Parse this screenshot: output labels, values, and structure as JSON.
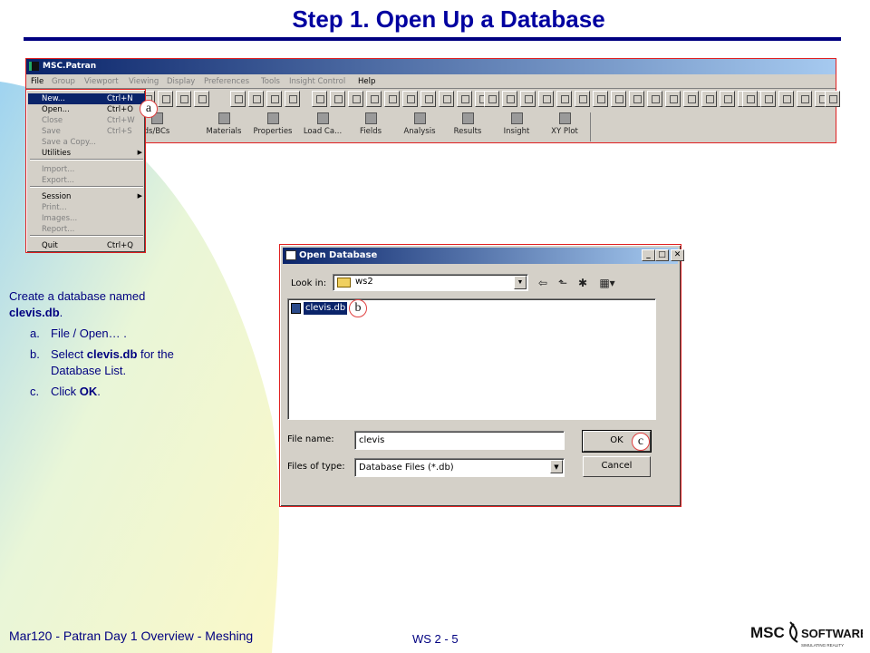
{
  "slide": {
    "title": "Step 1.  Open Up a Database",
    "footer_left": "Mar120 - Patran Day 1 Overview - Meshing",
    "footer_page": "WS 2 - 5",
    "logo_text": "MSC",
    "logo_text2": "SOFTWARE",
    "logo_tagline": "SIMULATING REALITY",
    "colors": {
      "title": "#0000a0",
      "rule": "#000080",
      "callout_border": "#e04040"
    }
  },
  "patran": {
    "window_title": "MSC.Patran",
    "menus": [
      "File",
      "Group",
      "Viewport",
      "Viewing",
      "Display",
      "Preferences",
      "Tools",
      "Insight Control",
      "Help"
    ],
    "app_buttons": [
      "ds/BCs",
      "Materials",
      "Properties",
      "Load Ca...",
      "Fields",
      "Analysis",
      "Results",
      "Insight",
      "XY Plot"
    ],
    "file_menu": [
      {
        "label": "New...",
        "accel": "Ctrl+N",
        "state": "selected"
      },
      {
        "label": "Open...",
        "accel": "Ctrl+O",
        "state": "enabled"
      },
      {
        "label": "Close",
        "accel": "Ctrl+W",
        "state": "disabled"
      },
      {
        "label": "Save",
        "accel": "Ctrl+S",
        "state": "disabled"
      },
      {
        "label": "Save a Copy...",
        "accel": "",
        "state": "disabled"
      },
      {
        "label": "Utilities",
        "accel": "",
        "state": "enabled",
        "submenu": true
      },
      {
        "label": "Import...",
        "accel": "",
        "state": "disabled"
      },
      {
        "label": "Export...",
        "accel": "",
        "state": "disabled"
      },
      {
        "label": "Session",
        "accel": "",
        "state": "enabled",
        "submenu": true
      },
      {
        "label": "Print...",
        "accel": "",
        "state": "disabled"
      },
      {
        "label": "Images...",
        "accel": "",
        "state": "disabled"
      },
      {
        "label": "Report...",
        "accel": "",
        "state": "disabled"
      },
      {
        "label": "Quit",
        "accel": "Ctrl+Q",
        "state": "enabled"
      }
    ]
  },
  "callouts": {
    "a": "a",
    "b": "b",
    "c": "c"
  },
  "instructions": {
    "intro_prefix": "Create a database named",
    "intro_file": "clevis.db",
    "intro_suffix": ".",
    "step_a_letter": "a.",
    "step_a_text": "File / Open… .",
    "step_b_letter": "b.",
    "step_b_prefix": "Select ",
    "step_b_file": "clevis.db",
    "step_b_suffix": " for the Database List.",
    "step_c_letter": "c.",
    "step_c_prefix": "Click ",
    "step_c_ok": "OK",
    "step_c_suffix": "."
  },
  "dialog": {
    "title": "Open Database",
    "controls": {
      "minimize": "_",
      "maximize": "□",
      "close": "✕"
    },
    "look_in_label": "Look in:",
    "look_in_value": "ws2",
    "files": [
      "clevis.db"
    ],
    "file_name_label": "File name:",
    "file_name_value": "clevis",
    "files_of_type_label": "Files of type:",
    "files_of_type_value": "Database Files (*.db)",
    "ok_label": "OK",
    "cancel_label": "Cancel"
  }
}
